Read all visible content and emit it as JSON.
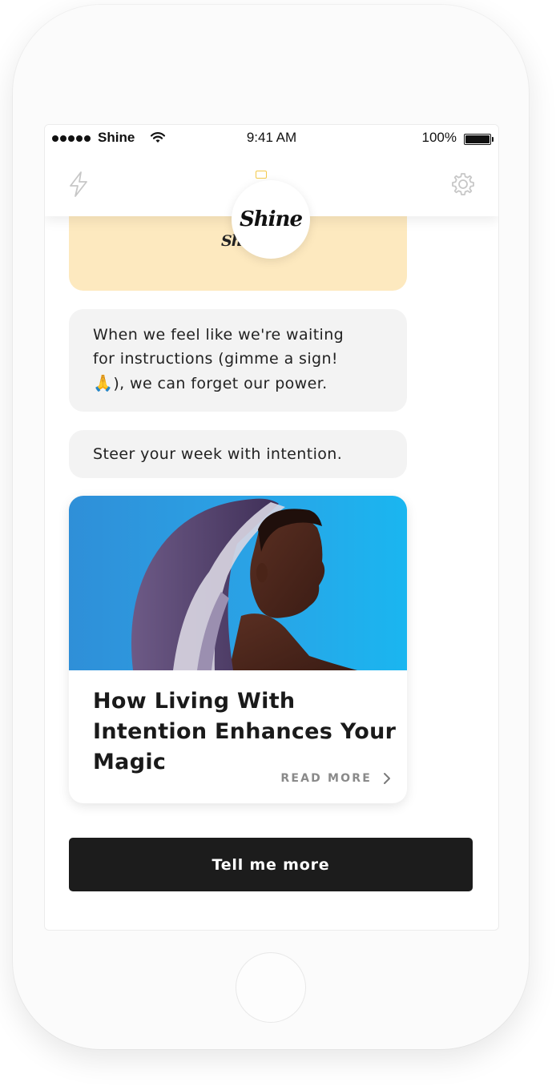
{
  "status_bar": {
    "carrier": "Shine",
    "time": "9:41 AM",
    "battery": "100%"
  },
  "nav": {
    "left_icon": "lightning-bolt-icon",
    "right_icon": "gear-icon",
    "logo_text": "Shine"
  },
  "chat": {
    "card_logo_text": "Shine",
    "messages": [
      {
        "line1": "When we feel like we're waiting",
        "line2": "for instructions (gimme a sign!",
        "emoji": "🙏",
        "line3": "), we can forget our power."
      },
      {
        "text": "Steer your week with intention."
      }
    ],
    "article": {
      "image_alt": "woman wearing a purple and white headscarf against blue background",
      "title": "How Living With Intention Enhances Your Magic",
      "read_more": "READ MORE"
    }
  },
  "cta": {
    "label": "Tell me more"
  },
  "colors": {
    "yellow_card": "#fde9bf",
    "bubble_bg": "#f3f3f3",
    "cta_bg": "#1c1c1c",
    "image_bg": "#2aa3e6"
  }
}
